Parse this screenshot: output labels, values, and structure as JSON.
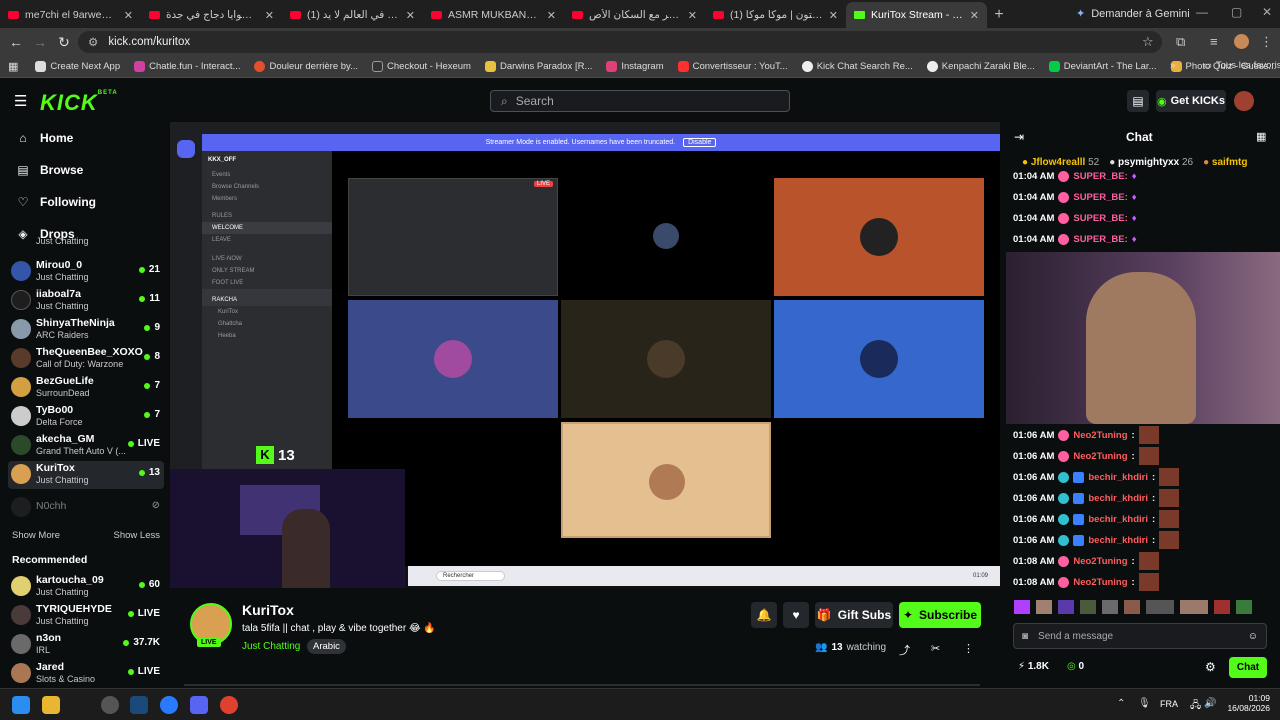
{
  "browser": {
    "tabs": [
      {
        "title": "me7chi el 9arwen - YouTube"
      },
      {
        "title": "أفضل شوايا دجاج في جدة"
      },
      {
        "title": "(1) أجمل بلد في العالم لا يد..."
      },
      {
        "title": "ASMR MUKBANG | GRILL..."
      },
      {
        "title": "دخلت البحر مع السكان الأص..."
      },
      {
        "title": "(1) سبيستون | موكا موكا | ..."
      },
      {
        "title": "KuriTox Stream - Watch Li..."
      }
    ],
    "gemini": "Demander à Gemini",
    "url": "kick.com/kuritox",
    "bookmarks": [
      "Create Next App",
      "Chatle.fun - Interact...",
      "Douleur derrière by...",
      "Checkout - Hexeum",
      "Darwins Paradox [R...",
      "Instagram",
      "Convertisseur : YouT...",
      "Kick Chat Search Re...",
      "Kenpachi Zaraki Ble...",
      "DeviantArt - The Lar...",
      "Photo Quiz - Guess..."
    ],
    "all_bookmarks": "Tous les favoris"
  },
  "kick": {
    "logo": "KICK",
    "logo_sup": "BETA",
    "search_placeholder": "Search",
    "get_kicks": "Get KICKs"
  },
  "sidebar": {
    "nav": [
      {
        "label": "Home"
      },
      {
        "label": "Browse"
      },
      {
        "label": "Following"
      },
      {
        "label": "Drops"
      }
    ],
    "following": [
      {
        "name": "",
        "category": "Just Chatting",
        "viewers": "",
        "color": "#3a5f8a"
      },
      {
        "name": "Mirou0_0",
        "category": "Just Chatting",
        "viewers": "21",
        "color": "#3355aa"
      },
      {
        "name": "iiaboal7a",
        "category": "Just Chatting",
        "viewers": "11",
        "color": "#1e1e1e"
      },
      {
        "name": "ShinyaTheNinja",
        "category": "ARC Raiders",
        "viewers": "9",
        "color": "#8899aa"
      },
      {
        "name": "TheQueenBee_XOXO",
        "category": "Call of Duty: Warzone",
        "viewers": "8",
        "color": "#5a3a2a"
      },
      {
        "name": "BezGueLife",
        "category": "SurrounDead",
        "viewers": "7",
        "color": "#d2a040"
      },
      {
        "name": "TyBo00",
        "category": "Delta Force",
        "viewers": "7",
        "color": "#cccccc"
      },
      {
        "name": "akecha_GM",
        "category": "Grand Theft Auto V (...",
        "viewers": "LIVE",
        "color": "#2a4a2a"
      },
      {
        "name": "KuriTox",
        "category": "Just Chatting",
        "viewers": "13",
        "color": "#d8a050"
      },
      {
        "name": "N0chh",
        "category": "",
        "viewers": "",
        "color": "#333333"
      }
    ],
    "show_more": "Show More",
    "show_less": "Show Less",
    "recommended_title": "Recommended",
    "recommended": [
      {
        "name": "kartoucha_09",
        "category": "Just Chatting",
        "viewers": "60",
        "color": "#e0d070"
      },
      {
        "name": "TYRIQUEHYDE",
        "category": "Just Chatting",
        "viewers": "LIVE",
        "color": "#4a3a3a"
      },
      {
        "name": "n3on",
        "category": "IRL",
        "viewers": "37.7K",
        "color": "#6a6a6a"
      },
      {
        "name": "Jared",
        "category": "Slots & Casino",
        "viewers": "LIVE",
        "color": "#aa7755"
      }
    ]
  },
  "video": {
    "discord_banner": "Streamer Mode is enabled. Usernames have been truncated.",
    "discord_disable": "Disable",
    "server_name": "KKX_OFF",
    "discord_channels": [
      "Events",
      "Browse Channels",
      "Members",
      "RULES",
      "WELCOME",
      "LEAVE",
      "LIVE-NOW",
      "ONLY STREAM",
      "FOOT LIVE",
      "RAKCHA",
      "KuriTox",
      "Ghaltcha",
      "Heeba"
    ],
    "live_badge": "LIVE",
    "overlay_count": "13",
    "taskbar_search": "Rechercher",
    "clock": "01:09"
  },
  "stream": {
    "streamer": "KuriTox",
    "title": "tala 5fifa || chat , play & vibe together 😂 🔥",
    "category": "Just Chatting",
    "tag": "Arabic",
    "live": "LIVE",
    "watching_count": "13",
    "watching_label": "watching",
    "gift_subs": "Gift Subs",
    "subscribe": "Subscribe"
  },
  "chat": {
    "title": "Chat",
    "top_gifters": [
      {
        "name": "Jflow4realll",
        "count": "52"
      },
      {
        "name": "psymightyxx",
        "count": "26"
      },
      {
        "name": "saifmtg",
        "count": ""
      }
    ],
    "messages_top": [
      {
        "time": "01:04 AM",
        "user": "SUPER_BE:"
      },
      {
        "time": "01:04 AM",
        "user": "SUPER_BE:"
      },
      {
        "time": "01:04 AM",
        "user": "SUPER_BE:"
      },
      {
        "time": "01:04 AM",
        "user": "SUPER_BE:"
      }
    ],
    "messages_bottom": [
      {
        "time": "01:06 AM",
        "user": "Neo2Tuning",
        "color": "#ff5d5d"
      },
      {
        "time": "01:06 AM",
        "user": "Neo2Tuning",
        "color": "#ff5d5d"
      },
      {
        "time": "01:06 AM",
        "user": "bechir_khdiri",
        "color": "#ff5d5d"
      },
      {
        "time": "01:06 AM",
        "user": "bechir_khdiri",
        "color": "#ff5d5d"
      },
      {
        "time": "01:06 AM",
        "user": "bechir_khdiri",
        "color": "#ff5d5d"
      },
      {
        "time": "01:06 AM",
        "user": "bechir_khdiri",
        "color": "#ff5d5d"
      },
      {
        "time": "01:08 AM",
        "user": "Neo2Tuning",
        "color": "#ff5d5d"
      },
      {
        "time": "01:08 AM",
        "user": "Neo2Tuning",
        "color": "#ff5d5d"
      }
    ],
    "input_placeholder": "Send a message",
    "kicks": "1.8K",
    "points": "0",
    "send": "Chat"
  },
  "taskbar": {
    "lang": "FRA",
    "time": "01:09",
    "date": "16/08/2026"
  },
  "colors": {
    "kick_green": "#53fc18",
    "bg": "#0b0e0f",
    "discord_purple": "#5865f2"
  }
}
